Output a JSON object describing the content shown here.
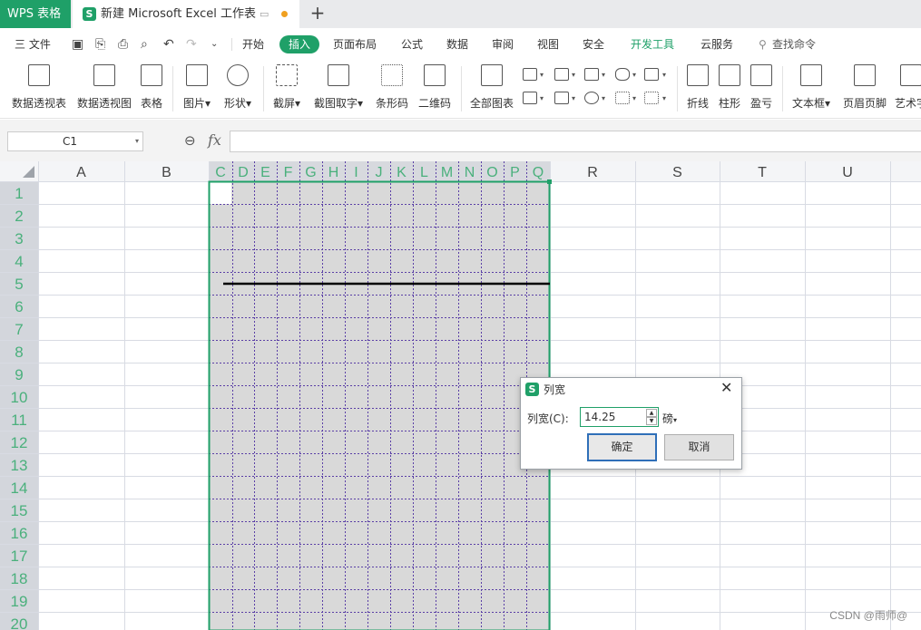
{
  "title_bar": {
    "app_tab": "WPS 表格",
    "doc_tab_title": "新建 Microsoft Excel 工作表",
    "new_tab": "+"
  },
  "menu": {
    "file": "三 文件",
    "items": [
      "开始",
      "插入",
      "页面布局",
      "公式",
      "数据",
      "审阅",
      "视图",
      "安全",
      "开发工具",
      "云服务"
    ],
    "active_index": 1,
    "search": "查找命令"
  },
  "ribbon": {
    "buttons": [
      "数据透视表",
      "数据透视图",
      "表格",
      "图片",
      "形状",
      "截屏",
      "截图取字",
      "条形码",
      "二维码",
      "全部图表",
      "折线",
      "柱形",
      "盈亏",
      "文本框",
      "页眉页脚",
      "艺术字"
    ]
  },
  "formula_bar": {
    "name_box": "C1",
    "fx_label": "fx",
    "formula": ""
  },
  "sheet": {
    "columns": [
      "A",
      "B",
      "C",
      "D",
      "E",
      "F",
      "G",
      "H",
      "I",
      "J",
      "K",
      "L",
      "M",
      "N",
      "O",
      "P",
      "Q",
      "R",
      "S",
      "T",
      "U"
    ],
    "rows": [
      1,
      2,
      3,
      4,
      5,
      6,
      7,
      8,
      9,
      10,
      11,
      12,
      13,
      14,
      15,
      16,
      17,
      18,
      19,
      20
    ],
    "selected_range": "C1:Q20",
    "line_row": 5
  },
  "dialog": {
    "title": "列宽",
    "field_label": "列宽(C):",
    "value": "14.25",
    "unit": "磅",
    "ok": "确定",
    "cancel": "取消"
  },
  "watermark": "CSDN @雨师@",
  "colors": {
    "accent": "#1fa068",
    "selection_fill": "#d8d8d8",
    "grid_line": "#d8dbe3",
    "header_bg": "#f4f5f7",
    "dotted_grid": "#5a3fa6",
    "selected_header_text": "#4ab07c"
  }
}
